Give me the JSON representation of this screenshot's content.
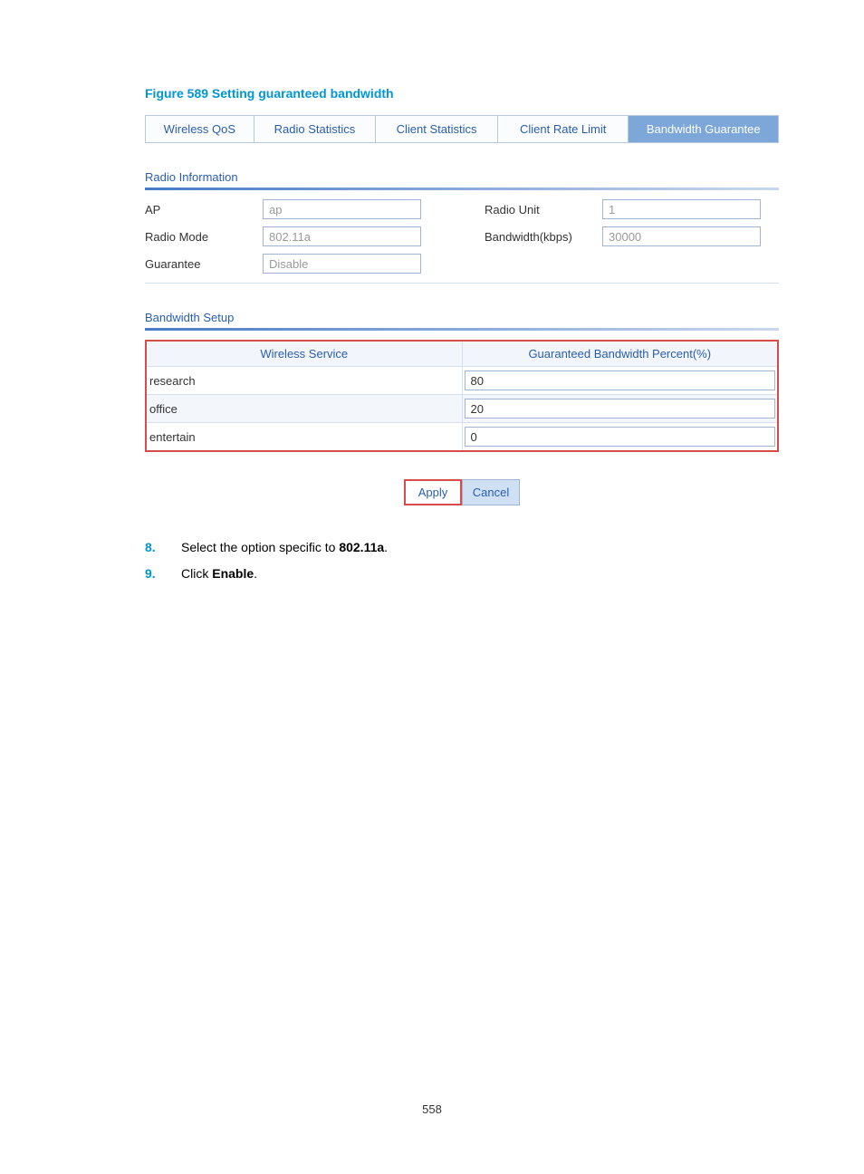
{
  "figure_title": "Figure 589 Setting guaranteed bandwidth",
  "tabs": {
    "t1": "Wireless QoS",
    "t2": "Radio Statistics",
    "t3": "Client Statistics",
    "t4": "Client Rate Limit",
    "t5": "Bandwidth Guarantee"
  },
  "sections": {
    "radio_info_title": "Radio Information",
    "bandwidth_setup_title": "Bandwidth Setup"
  },
  "radio_info": {
    "ap_label": "AP",
    "ap_value": "ap",
    "radio_unit_label": "Radio Unit",
    "radio_unit_value": "1",
    "radio_mode_label": "Radio Mode",
    "radio_mode_value": "802.11a",
    "bandwidth_label": "Bandwidth(kbps)",
    "bandwidth_value": "30000",
    "guarantee_label": "Guarantee",
    "guarantee_value": "Disable"
  },
  "bw_table": {
    "col1": "Wireless Service",
    "col2": "Guaranteed Bandwidth Percent(%)",
    "rows": [
      {
        "service": "research",
        "percent": "80"
      },
      {
        "service": "office",
        "percent": "20"
      },
      {
        "service": "entertain",
        "percent": "0"
      }
    ]
  },
  "buttons": {
    "apply": "Apply",
    "cancel": "Cancel"
  },
  "steps": {
    "s8_num": "8.",
    "s8_a": "Select the option specific to ",
    "s8_b": "802.11a",
    "s8_c": ".",
    "s9_num": "9.",
    "s9_a": "Click ",
    "s9_b": "Enable",
    "s9_c": "."
  },
  "page_number": "558"
}
